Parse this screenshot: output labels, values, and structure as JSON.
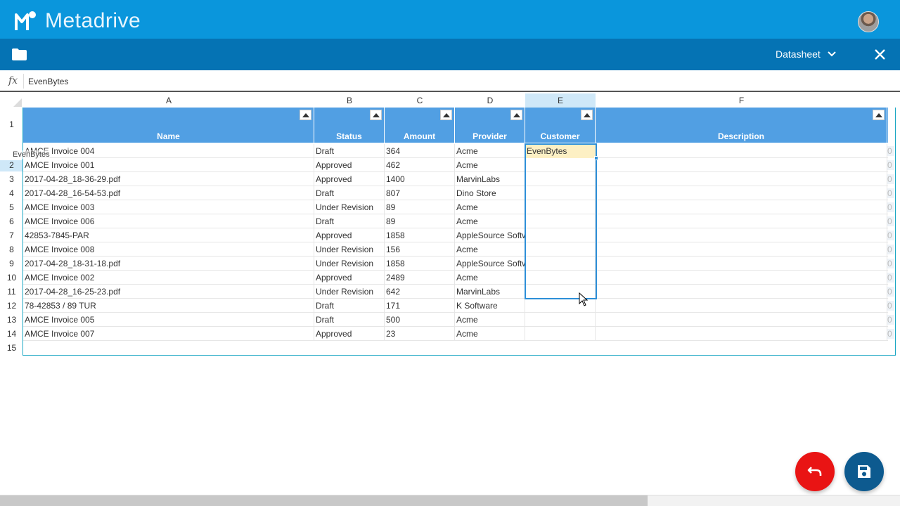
{
  "app": {
    "name": "Metadrive"
  },
  "toolbar": {
    "view_label": "Datasheet"
  },
  "formula_bar": {
    "fx_label": "fx",
    "value": "EvenBytes"
  },
  "columns": [
    {
      "letter": "A",
      "name": "Name"
    },
    {
      "letter": "B",
      "name": "Status"
    },
    {
      "letter": "C",
      "name": "Amount"
    },
    {
      "letter": "D",
      "name": "Provider"
    },
    {
      "letter": "E",
      "name": "Customer"
    },
    {
      "letter": "F",
      "name": "Description"
    }
  ],
  "row_numbers": [
    "1",
    "2",
    "3",
    "4",
    "5",
    "6",
    "7",
    "8",
    "9",
    "10",
    "11",
    "12",
    "13",
    "14",
    "15"
  ],
  "rows": [
    {
      "name": "AMCE Invoice 004",
      "status": "Draft",
      "amount": "364",
      "provider": "Acme",
      "customer": "EvenBytes",
      "description": "",
      "extra": "0"
    },
    {
      "name": "AMCE Invoice 001",
      "status": "Approved",
      "amount": "462",
      "provider": "Acme",
      "customer": "",
      "description": "",
      "extra": "0"
    },
    {
      "name": "2017-04-28_18-36-29.pdf",
      "status": "Approved",
      "amount": "1400",
      "provider": "MarvinLabs",
      "customer": "",
      "description": "",
      "extra": "0"
    },
    {
      "name": "2017-04-28_16-54-53.pdf",
      "status": "Draft",
      "amount": "807",
      "provider": "Dino Store",
      "customer": "",
      "description": "",
      "extra": "0"
    },
    {
      "name": "AMCE Invoice 003",
      "status": "Under Revision",
      "amount": "89",
      "provider": "Acme",
      "customer": "",
      "description": "",
      "extra": "0"
    },
    {
      "name": "AMCE Invoice 006",
      "status": "Draft",
      "amount": "89",
      "provider": "Acme",
      "customer": "",
      "description": "",
      "extra": "0"
    },
    {
      "name": "42853-7845-PAR",
      "status": "Approved",
      "amount": "1858",
      "provider": "AppleSource Softw",
      "customer": "",
      "description": "",
      "extra": "0"
    },
    {
      "name": "AMCE Invoice 008",
      "status": "Under Revision",
      "amount": "156",
      "provider": "Acme",
      "customer": "",
      "description": "",
      "extra": "0"
    },
    {
      "name": "2017-04-28_18-31-18.pdf",
      "status": "Under Revision",
      "amount": "1858",
      "provider": "AppleSource Softw",
      "customer": "",
      "description": "",
      "extra": "0"
    },
    {
      "name": "AMCE Invoice 002",
      "status": "Approved",
      "amount": "2489",
      "provider": "Acme",
      "customer": "",
      "description": "",
      "extra": "0"
    },
    {
      "name": "2017-04-28_16-25-23.pdf",
      "status": "Under Revision",
      "amount": "642",
      "provider": "MarvinLabs",
      "customer": "",
      "description": "",
      "extra": "0"
    },
    {
      "name": "78-42853 / 89 TUR",
      "status": "Draft",
      "amount": "171",
      "provider": "K Software",
      "customer": "",
      "description": "",
      "extra": "0"
    },
    {
      "name": "AMCE Invoice 005",
      "status": "Draft",
      "amount": "500",
      "provider": "Acme",
      "customer": "",
      "description": "",
      "extra": "0"
    },
    {
      "name": "AMCE Invoice 007",
      "status": "Approved",
      "amount": "23",
      "provider": "Acme",
      "customer": "",
      "description": "",
      "extra": "0"
    }
  ],
  "selection": {
    "column": "E",
    "active_value": "EvenBytes",
    "drag_ghost": "EvenBytes"
  },
  "colors": {
    "topbar": "#0a96dc",
    "subbar": "#0573b4",
    "header": "#519fe3",
    "undo": "#e91414",
    "save": "#0d5a8f"
  },
  "icons": {
    "folder": "folder-icon",
    "close": "close-icon",
    "undo": "undo-icon",
    "save": "save-icon",
    "sort": "sort-asc-icon"
  }
}
